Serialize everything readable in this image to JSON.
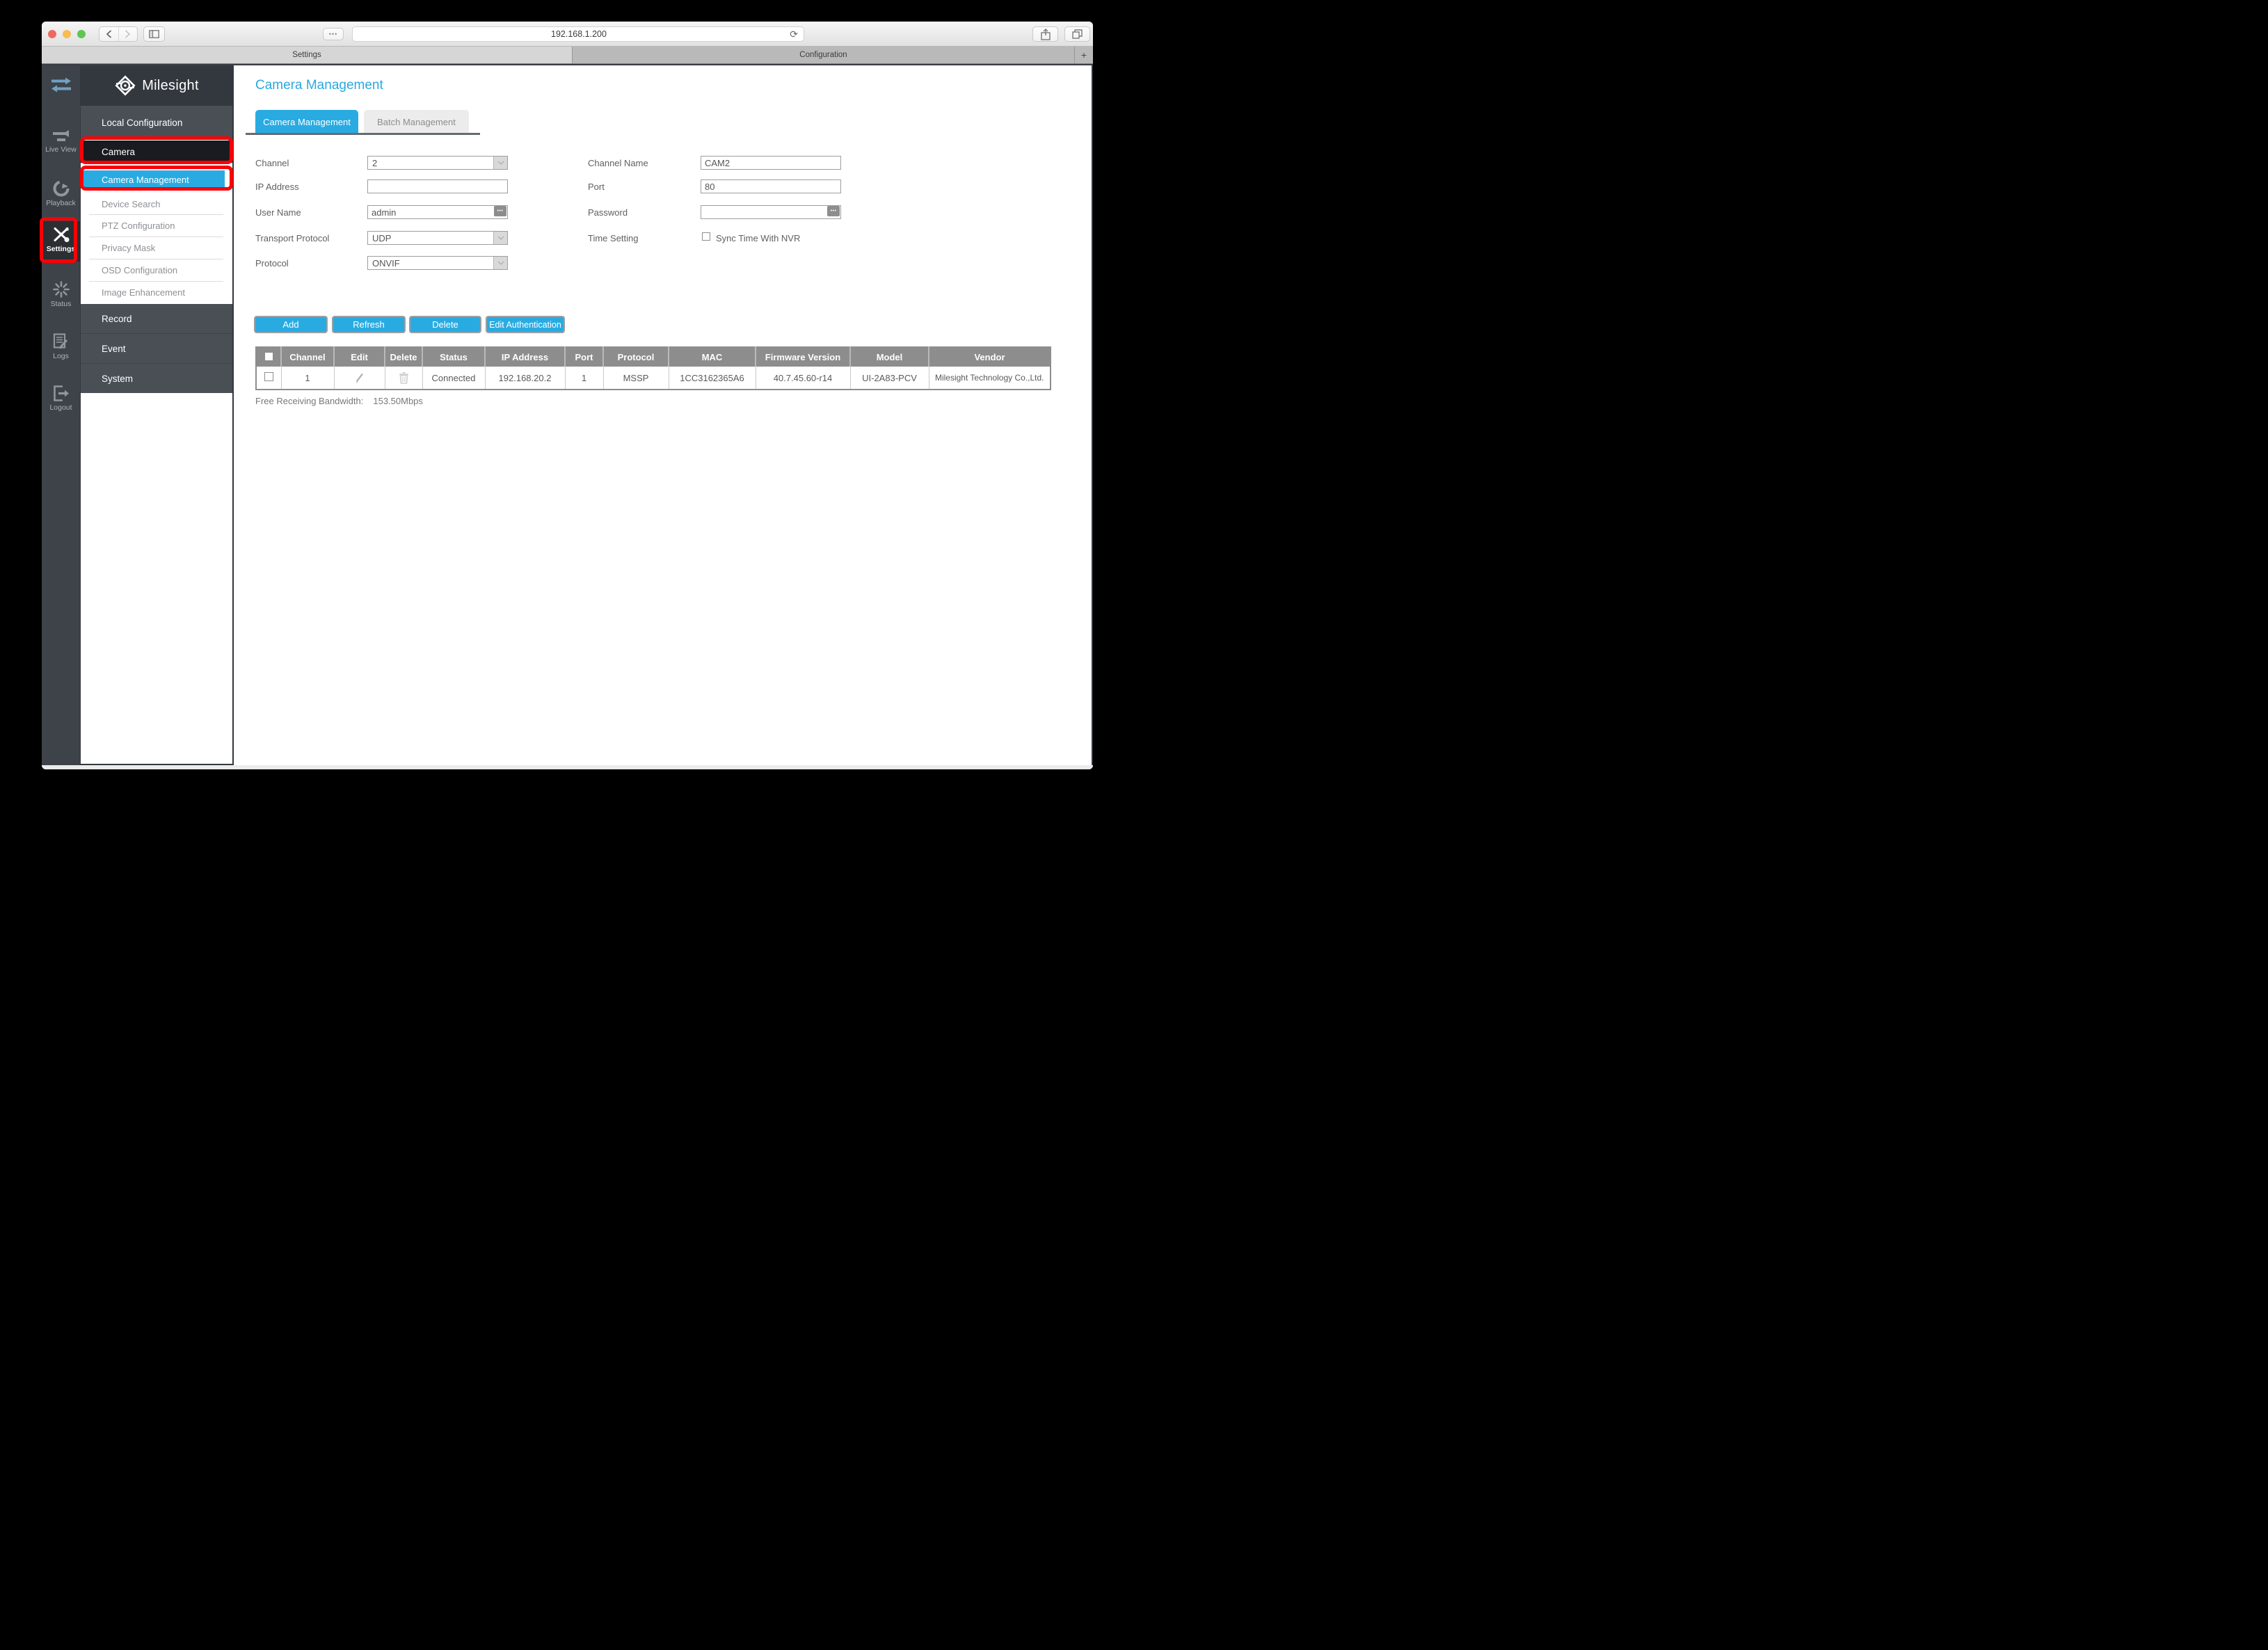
{
  "colors": {
    "accent": "#29abe2",
    "page_title": "#2aa9e0",
    "annotation_red": "#fb0007",
    "table_header_gray": "#8d8d8d"
  },
  "browser": {
    "url": "192.168.1.200",
    "tabs": [
      {
        "label": "Settings"
      },
      {
        "label": "Configuration"
      }
    ],
    "new_tab_glyph": "+",
    "refresh_glyph": "⟳",
    "dots_glyph": "•••"
  },
  "sidebar": {
    "items": [
      {
        "label": "Live View"
      },
      {
        "label": "Playback"
      },
      {
        "label": "Settings"
      },
      {
        "label": "Status"
      },
      {
        "label": "Logs"
      },
      {
        "label": "Logout"
      }
    ]
  },
  "menu": {
    "brand": "Milesight",
    "local_configuration": "Local Configuration",
    "camera": "Camera",
    "camera_management": "Camera Management",
    "device_search": "Device Search",
    "ptz_configuration": "PTZ Configuration",
    "privacy_mask": "Privacy Mask",
    "osd_configuration": "OSD Configuration",
    "image_enhancement": "Image Enhancement",
    "record": "Record",
    "event": "Event",
    "system": "System"
  },
  "page": {
    "title": "Camera Management",
    "tabs": [
      {
        "label": "Camera Management"
      },
      {
        "label": "Batch Management"
      }
    ]
  },
  "form": {
    "channel": {
      "label": "Channel",
      "value": "2"
    },
    "ip_address": {
      "label": "IP Address",
      "value": ""
    },
    "user_name": {
      "label": "User Name",
      "value": "admin"
    },
    "transport_protocol": {
      "label": "Transport Protocol",
      "value": "UDP"
    },
    "protocol": {
      "label": "Protocol",
      "value": "ONVIF"
    },
    "channel_name": {
      "label": "Channel Name",
      "value": "CAM2"
    },
    "port": {
      "label": "Port",
      "value": "80"
    },
    "password": {
      "label": "Password",
      "value": ""
    },
    "time_setting": {
      "label": "Time Setting",
      "checkbox_label": "Sync Time With NVR",
      "checked": false
    },
    "ellipsis_glyph": "•••"
  },
  "actions": {
    "add": "Add",
    "refresh": "Refresh",
    "delete": "Delete",
    "edit_authentication": "Edit Authentication"
  },
  "table": {
    "columns": [
      "",
      "Channel",
      "Edit",
      "Delete",
      "Status",
      "IP Address",
      "Port",
      "Protocol",
      "MAC",
      "Firmware Version",
      "Model",
      "Vendor"
    ],
    "rows": [
      {
        "selected": false,
        "channel": "1",
        "status": "Connected",
        "ip_address": "192.168.20.2",
        "port": "1",
        "protocol": "MSSP",
        "mac": "1CC3162365A6",
        "firmware": "40.7.45.60-r14",
        "model": "UI-2A83-PCV",
        "vendor": "Milesight Technology Co.,Ltd."
      }
    ]
  },
  "footer": {
    "bandwidth_label": "Free Receiving Bandwidth:",
    "bandwidth_value": "153.50Mbps"
  }
}
